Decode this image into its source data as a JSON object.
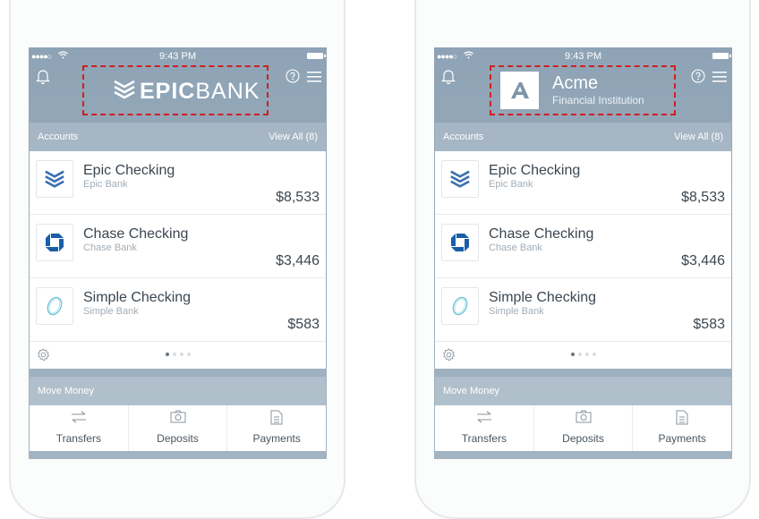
{
  "phones": [
    {
      "status": {
        "signal": "●●●●○",
        "wifi": "wifi-icon",
        "time": "9:43 PM"
      },
      "brand": {
        "logo_icon": "epic-chevron-icon",
        "name_bold": "EPIC",
        "name_light": "BANK"
      },
      "accounts": {
        "header": "Accounts",
        "view_all": "View All (8)",
        "items": [
          {
            "icon": "epic-chevron-icon",
            "name": "Epic Checking",
            "bank": "Epic Bank",
            "balance": "$8,533"
          },
          {
            "icon": "chase-octagon-icon",
            "name": "Chase Checking",
            "bank": "Chase Bank",
            "balance": "$3,446"
          },
          {
            "icon": "simple-oval-icon",
            "name": "Simple Checking",
            "bank": "Simple Bank",
            "balance": "$583"
          }
        ]
      },
      "move_money": {
        "header": "Move Money",
        "actions": [
          {
            "icon": "transfer-arrows-icon",
            "label": "Transfers"
          },
          {
            "icon": "camera-icon",
            "label": "Deposits"
          },
          {
            "icon": "document-icon",
            "label": "Payments"
          }
        ]
      }
    },
    {
      "status": {
        "signal": "●●●●○",
        "wifi": "wifi-icon",
        "time": "9:43 PM"
      },
      "brand": {
        "logo_icon": "acme-a-icon",
        "name": "Acme",
        "subtitle": "Financial Institution"
      },
      "accounts": {
        "header": "Accounts",
        "view_all": "View All (8)",
        "items": [
          {
            "icon": "epic-chevron-icon",
            "name": "Epic Checking",
            "bank": "Epic Bank",
            "balance": "$8,533"
          },
          {
            "icon": "chase-octagon-icon",
            "name": "Chase Checking",
            "bank": "Chase Bank",
            "balance": "$3,446"
          },
          {
            "icon": "simple-oval-icon",
            "name": "Simple Checking",
            "bank": "Simple Bank",
            "balance": "$583"
          }
        ]
      },
      "move_money": {
        "header": "Move Money",
        "actions": [
          {
            "icon": "transfer-arrows-icon",
            "label": "Transfers"
          },
          {
            "icon": "camera-icon",
            "label": "Deposits"
          },
          {
            "icon": "document-icon",
            "label": "Payments"
          }
        ]
      }
    }
  ],
  "colors": {
    "highlight_border": "#d01f1f",
    "epic_blue": "#3a6fb0",
    "chase_blue": "#1a5ea8",
    "simple_teal": "#6fc3d8"
  }
}
